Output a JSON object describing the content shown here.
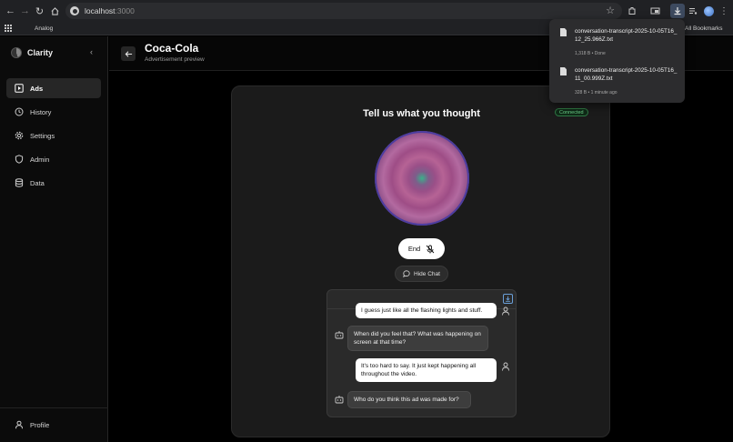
{
  "browser": {
    "url_host": "localhost",
    "url_port": ":3000",
    "bookmark_item": "Analog",
    "all_bookmarks": "All Bookmarks"
  },
  "sidebar": {
    "brand": "Clarity",
    "items": [
      {
        "label": "Ads",
        "icon": "ads-icon",
        "active": true
      },
      {
        "label": "History",
        "icon": "history-icon",
        "active": false
      },
      {
        "label": "Settings",
        "icon": "gear-icon",
        "active": false
      },
      {
        "label": "Admin",
        "icon": "shield-icon",
        "active": false
      },
      {
        "label": "Data",
        "icon": "database-icon",
        "active": false
      }
    ],
    "profile": "Profile"
  },
  "header": {
    "title": "Coca-Cola",
    "subtitle": "Advertisement preview"
  },
  "card": {
    "title": "Tell us what you thought",
    "status": "Connected",
    "end_label": "End",
    "hide_chat_label": "Hide Chat"
  },
  "chat": {
    "messages": [
      {
        "role": "user",
        "text": "I guess just like all the flashing lights and stuff."
      },
      {
        "role": "bot",
        "text": "When did you feel that? What was happening on screen at that time?"
      },
      {
        "role": "user",
        "text": "It's too hard to say. It just kept happening all throughout the video."
      },
      {
        "role": "bot",
        "text": "Who do you think this ad was made for?"
      }
    ]
  },
  "downloads": [
    {
      "name": "conversation-transcript-2025-10-05T16_12_25.966Z.txt",
      "meta": "1,318 B • Done"
    },
    {
      "name": "conversation-transcript-2025-10-05T16_11_00.999Z.txt",
      "meta": "328 B • 1 minute ago"
    }
  ],
  "colors": {
    "accent_status": "#6fd48d",
    "orb_center": "#3ab08a",
    "orb_edge": "#5b3a99"
  }
}
